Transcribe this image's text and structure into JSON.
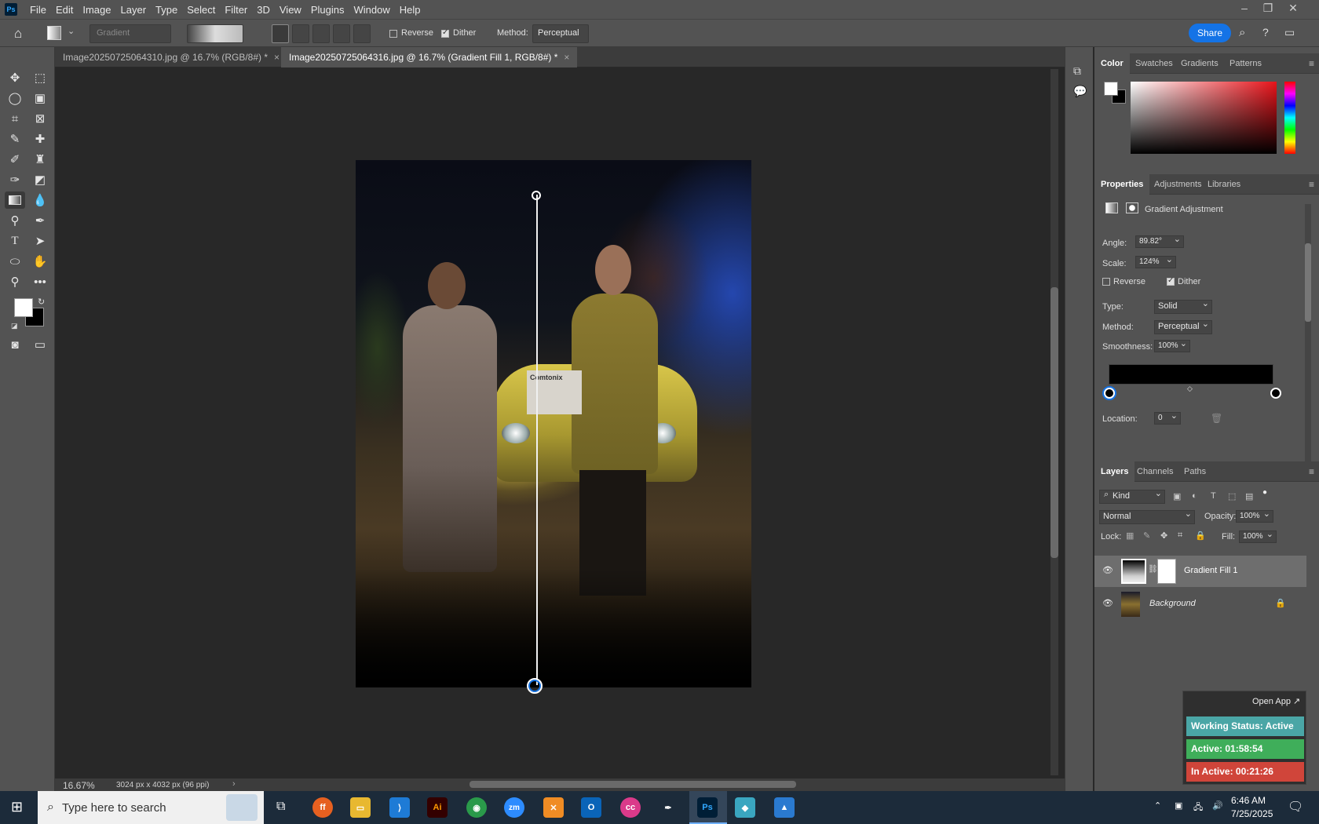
{
  "menubar": {
    "items": [
      "File",
      "Edit",
      "Image",
      "Layer",
      "Type",
      "Select",
      "Filter",
      "3D",
      "View",
      "Plugins",
      "Window",
      "Help"
    ],
    "logo": "Ps"
  },
  "options": {
    "preset": "Gradient",
    "reverse": "Reverse",
    "dither": "Dither",
    "method_label": "Method:",
    "method_value": "Perceptual",
    "share": "Share"
  },
  "tabs": [
    {
      "label": "Image20250725064310.jpg @ 16.7% (RGB/8#) *"
    },
    {
      "label": "Image20250725064316.jpg @ 16.7% (Gradient Fill 1, RGB/8#) *"
    }
  ],
  "status": {
    "zoom": "16.67%",
    "dims": "3024 px x 4032 px (96 ppi)"
  },
  "color_panel": {
    "tabs": [
      "Color",
      "Swatches",
      "Gradients",
      "Patterns"
    ]
  },
  "properties": {
    "tabs": [
      "Properties",
      "Adjustments",
      "Libraries"
    ],
    "title": "Gradient Adjustment",
    "angle_label": "Angle:",
    "angle": "89.82°",
    "scale_label": "Scale:",
    "scale": "124%",
    "reverse": "Reverse",
    "dither": "Dither",
    "type_label": "Type:",
    "type": "Solid",
    "method_label": "Method:",
    "method": "Perceptual",
    "smooth_label": "Smoothness:",
    "smooth": "100%",
    "location_label": "Location:",
    "location": "0"
  },
  "layers": {
    "tabs": [
      "Layers",
      "Channels",
      "Paths"
    ],
    "kind": "Kind",
    "blend": "Normal",
    "opacity_label": "Opacity:",
    "opacity": "100%",
    "lock_label": "Lock:",
    "fill_label": "Fill:",
    "fill": "100%",
    "items": [
      {
        "name": "Gradient Fill 1"
      },
      {
        "name": "Background"
      }
    ]
  },
  "widget": {
    "open": "Open App ↗",
    "working": "Working Status: Active",
    "active": "Active: 01:58:54",
    "inactive": "In Active: 00:21:26"
  },
  "taskbar": {
    "search": "Type here to search",
    "time": "6:46 AM",
    "date": "7/25/2025"
  },
  "photo": {
    "sign": "Comtonix"
  }
}
